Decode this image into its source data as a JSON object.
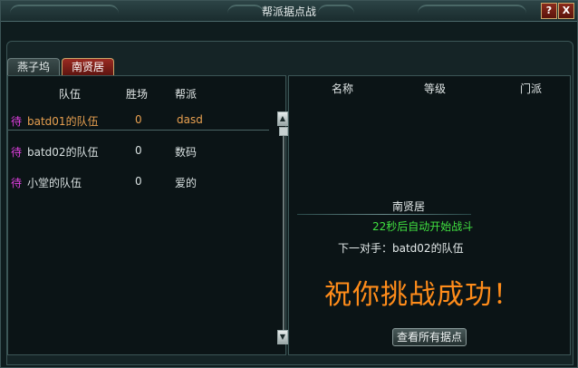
{
  "window": {
    "title": "帮派据点战"
  },
  "title_buttons": [
    {
      "label": "?",
      "icon": "help-icon"
    },
    {
      "label": "X",
      "icon": "close-icon"
    }
  ],
  "tabs": [
    {
      "label": "燕子坞",
      "active": false
    },
    {
      "label": "南贤居",
      "active": true
    }
  ],
  "left_panel": {
    "columns": [
      "队伍",
      "胜场",
      "帮派"
    ],
    "rows": [
      {
        "status": "待",
        "team": "batd01的队伍",
        "wins": "0",
        "guild": "dasd",
        "selected": true
      },
      {
        "status": "待",
        "team": "batd02的队伍",
        "wins": "0",
        "guild": "数码",
        "selected": false
      },
      {
        "status": "待",
        "team": "小堂的队伍",
        "wins": "0",
        "guild": "爱的",
        "selected": false
      }
    ]
  },
  "right_panel": {
    "columns": [
      "名称",
      "等级",
      "门派"
    ],
    "location": "南贤居",
    "countdown": "22秒后自动开始战斗",
    "next_opponent": "下一对手：batd02的队伍",
    "congrats": "祝你挑战成功！",
    "view_all_button": "查看所有据点"
  },
  "colors": {
    "status": "#e040e0",
    "selected_row": "#e8a050",
    "countdown": "#40e040",
    "congrats": "#ff8c1a",
    "active_tab": "#8a2218"
  }
}
